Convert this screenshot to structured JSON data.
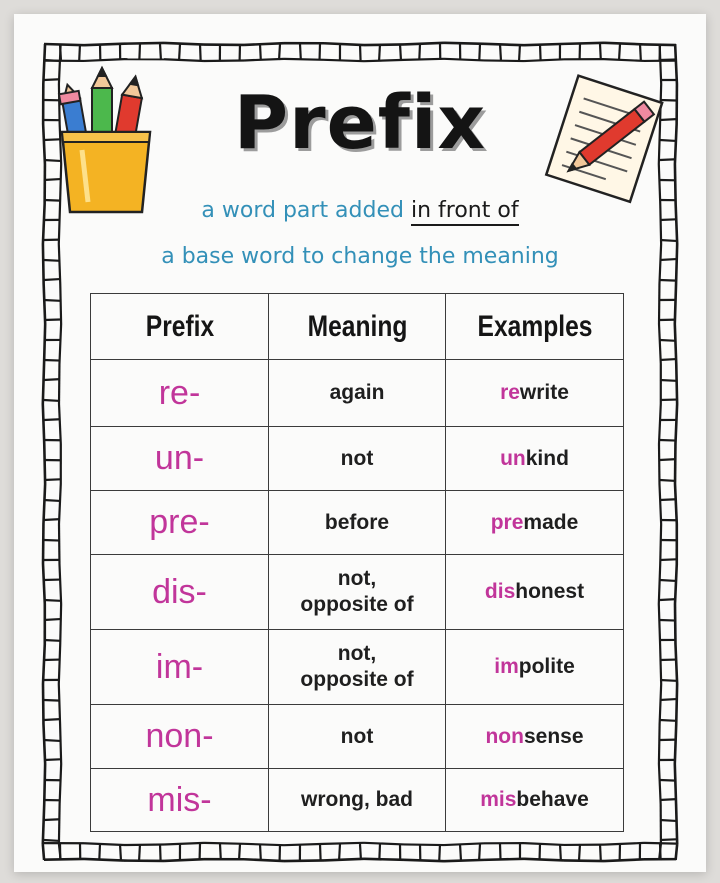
{
  "title": "Prefix",
  "definition": {
    "line1_start": "a word part added",
    "line1_highlight": "in front of",
    "line2": "a base word to change the meaning"
  },
  "table": {
    "headers": [
      "Prefix",
      "Meaning",
      "Examples"
    ],
    "rows": [
      {
        "prefix": "re-",
        "meaning": "again",
        "example_prefix": "re",
        "example_rest": "write"
      },
      {
        "prefix": "un-",
        "meaning": "not",
        "example_prefix": "un",
        "example_rest": "kind"
      },
      {
        "prefix": "pre-",
        "meaning": "before",
        "example_prefix": "pre",
        "example_rest": "made"
      },
      {
        "prefix": "dis-",
        "meaning_line1": "not,",
        "meaning_line2": "opposite of",
        "example_prefix": "dis",
        "example_rest": "honest"
      },
      {
        "prefix": "im-",
        "meaning_line1": "not,",
        "meaning_line2": "opposite of",
        "example_prefix": "im",
        "example_rest": "polite"
      },
      {
        "prefix": "non-",
        "meaning": "not",
        "example_prefix": "non",
        "example_rest": "sense"
      },
      {
        "prefix": "mis-",
        "meaning": "wrong, bad",
        "example_prefix": "mis",
        "example_rest": "behave"
      }
    ]
  },
  "colors": {
    "prefix_accent": "#c1359a",
    "definition_text": "#3390b8",
    "border": "#1a1a1a"
  },
  "icons": [
    "pencil-cup-icon",
    "notepad-pencil-icon"
  ]
}
